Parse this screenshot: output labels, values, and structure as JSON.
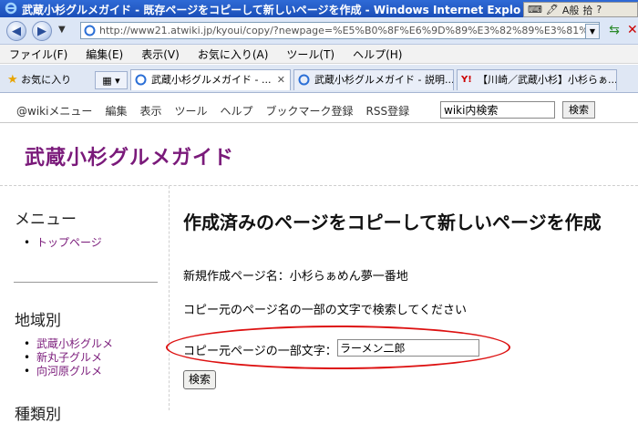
{
  "window": {
    "title": "武蔵小杉グルメガイド - 既存ページをコピーして新しいページを作成 - Windows Internet Explo",
    "ime": {
      "items": [
        "A般",
        "拾"
      ]
    }
  },
  "browser": {
    "address": "http://www21.atwiki.jp/kyoui/copy/?newpage=%E5%B0%8F%E6%9D%89%E3%82%89%E3%81%81%E3%82%81%E",
    "menu": [
      "ファイル(F)",
      "編集(E)",
      "表示(V)",
      "お気に入り(A)",
      "ツール(T)",
      "ヘルプ(H)"
    ],
    "favorites_label": "お気に入り",
    "tabs": [
      {
        "label": "武蔵小杉グルメガイド - ..."
      },
      {
        "label": "武蔵小杉グルメガイド - 説明..."
      },
      {
        "label": "【川崎／武蔵小杉】小杉らぁ..."
      }
    ]
  },
  "wiki": {
    "menu": [
      "@wikiメニュー",
      "編集",
      "表示",
      "ツール",
      "ヘルプ",
      "ブックマーク登録",
      "RSS登録"
    ],
    "search_value": "wiki内検索",
    "search_button": "検索",
    "site_title": "武蔵小杉グルメガイド"
  },
  "sidebar": {
    "menu_heading": "メニュー",
    "menu_items": [
      "トップページ"
    ],
    "region_heading": "地域別",
    "region_items": [
      "武蔵小杉グルメ",
      "新丸子グルメ",
      "向河原グルメ"
    ],
    "category_heading": "種類別"
  },
  "main": {
    "heading": "作成済みのページをコピーして新しいページを作成",
    "new_page_line": "新規作成ページ名：小杉らぁめん夢一番地",
    "instruction": "コピー元のページ名の一部の文字で検索してください",
    "copy_label": "コピー元ページの一部文字：",
    "copy_value": "ラーメン二郎",
    "submit_label": "検索"
  }
}
